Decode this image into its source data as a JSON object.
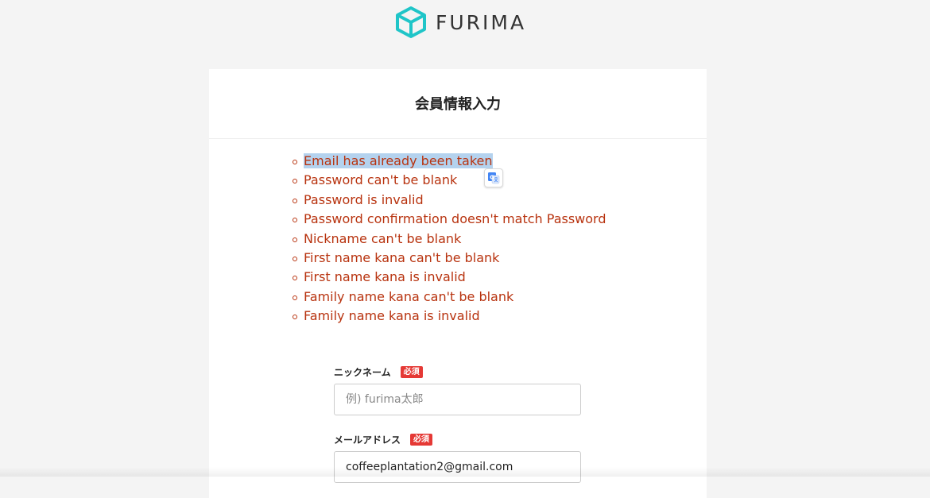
{
  "brand": {
    "name": "FURIMA",
    "accent": "#1fc5c8"
  },
  "page": {
    "title": "会員情報入力"
  },
  "errors": [
    "Email has already been taken",
    "Password can't be blank",
    "Password is invalid",
    "Password confirmation doesn't match Password",
    "Nickname can't be blank",
    "First name kana can't be blank",
    "First name kana is invalid",
    "Family name kana can't be blank",
    "Family name kana is invalid"
  ],
  "fields": {
    "nickname": {
      "label": "ニックネーム",
      "required": "必須",
      "placeholder": "例) furima太郎",
      "value": ""
    },
    "email": {
      "label": "メールアドレス",
      "required": "必須",
      "value": "coffeeplantation2@gmail.com"
    }
  },
  "colors": {
    "error": "#b8330f",
    "required_badge": "#e53935",
    "selection": "#b4d2ee"
  }
}
